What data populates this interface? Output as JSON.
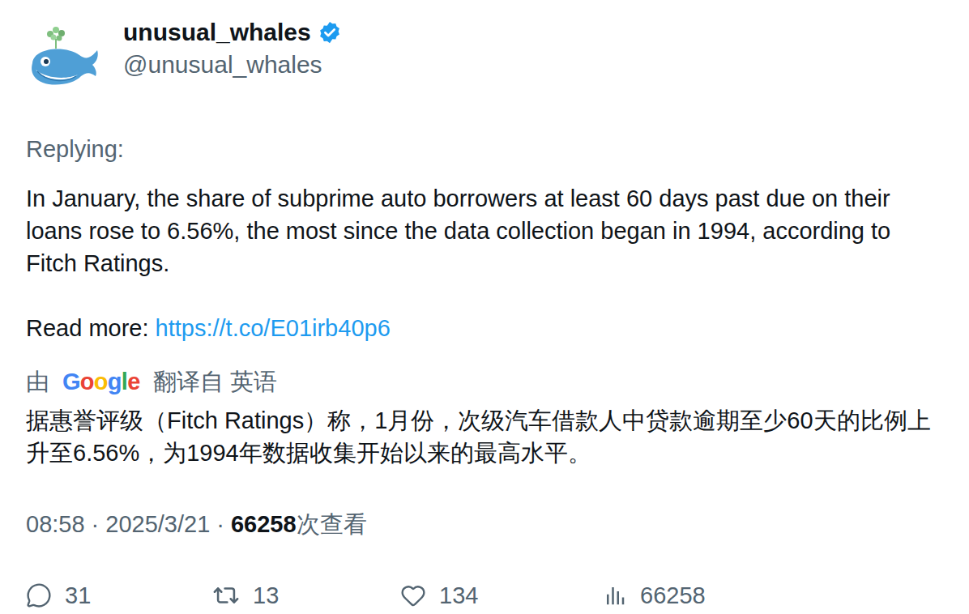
{
  "author": {
    "name": "unusual_whales",
    "handle": "@unusual_whales",
    "verified": true
  },
  "reply_label": "Replying:",
  "body": "In January, the share of subprime auto borrowers at least 60 days past due on their loans rose to 6.56%, the most since the data collection began in 1994, according to Fitch Ratings.",
  "link": {
    "label": "Read more: ",
    "url": "https://t.co/E01irb40p6"
  },
  "translation": {
    "prefix": "由",
    "provider": "Google",
    "provider_letter_colors": [
      "#4285F4",
      "#EA4335",
      "#FBBC05",
      "#4285F4",
      "#34A853",
      "#EA4335"
    ],
    "suffix": "翻译自 英语",
    "text": "据惠誉评级（Fitch Ratings）称，1月份，次级汽车借款人中贷款逾期至少60天的比例上升至6.56%，为1994年数据收集开始以来的最高水平。"
  },
  "meta": {
    "time": "08:58",
    "separator": "·",
    "date": "2025/3/21",
    "views": "66258",
    "views_label": "次查看"
  },
  "actions": [
    {
      "name": "reply",
      "count": "31"
    },
    {
      "name": "retweet",
      "count": "13"
    },
    {
      "name": "like",
      "count": "134"
    },
    {
      "name": "views",
      "count": "66258"
    }
  ]
}
